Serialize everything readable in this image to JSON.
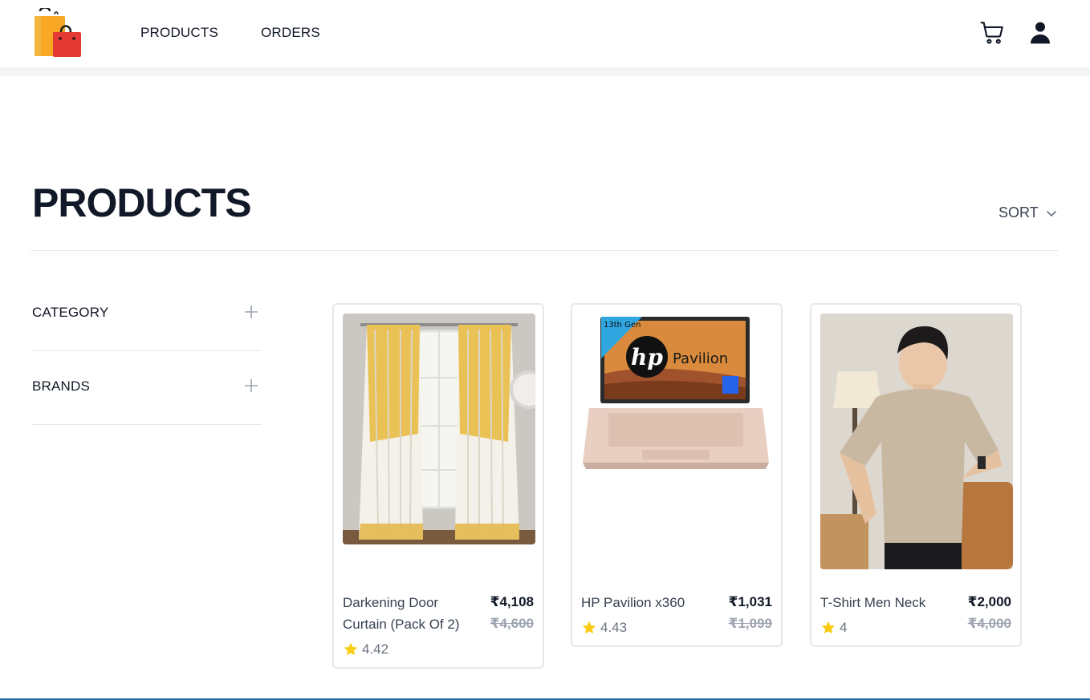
{
  "header": {
    "logo_icon": "shopping-bags-icon",
    "nav": [
      {
        "label": "PRODUCTS"
      },
      {
        "label": "ORDERS"
      }
    ],
    "cart_icon": "cart-icon",
    "user_icon": "user-icon"
  },
  "page": {
    "title": "PRODUCTS",
    "sort_label": "SORT"
  },
  "filters": [
    {
      "label": "CATEGORY"
    },
    {
      "label": "BRANDS"
    }
  ],
  "products": [
    {
      "name_line1": "Darkening Door",
      "name_line2": "Curtain (Pack Of 2)",
      "price": "₹4,108",
      "old_price": "₹4,600",
      "rating": "4.42"
    },
    {
      "name_line1": "HP Pavilion x360",
      "price": "₹1,031",
      "old_price": "₹1,099",
      "rating": "4.43",
      "image_text": {
        "badge": "13th Gen",
        "brand": "hp",
        "model": "Pavilion"
      }
    },
    {
      "name_line1": "T-Shirt Men Neck",
      "price": "₹2,000",
      "old_price": "₹4,000",
      "rating": "4"
    }
  ],
  "colors": {
    "accent_star": "#facc15",
    "title": "#111827",
    "muted": "#9ca3af",
    "bottom_border": "#1e6fb0"
  }
}
